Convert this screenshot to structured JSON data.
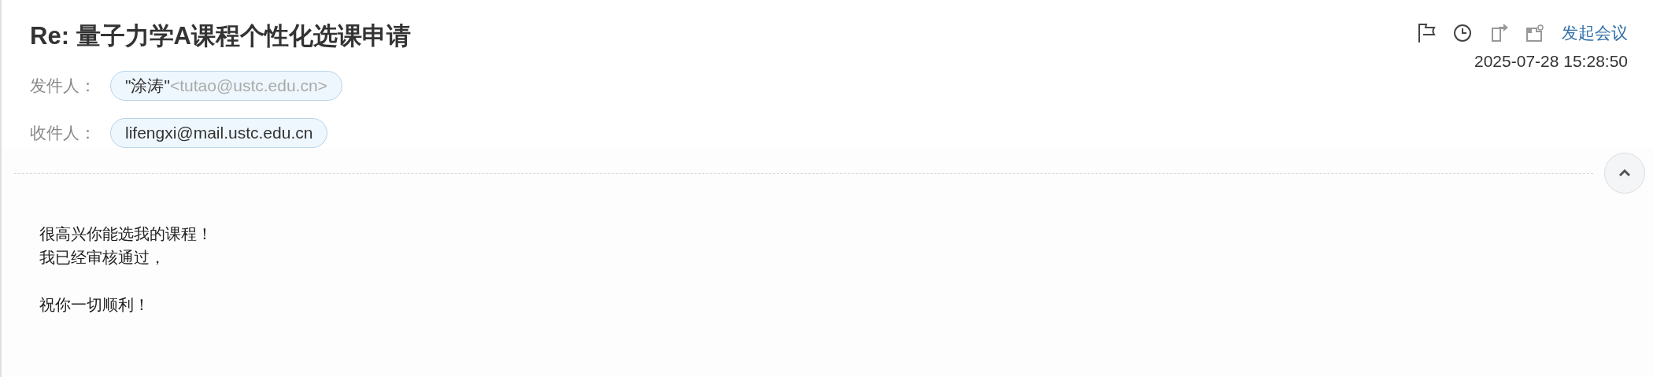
{
  "subject": "Re: 量子力学A课程个性化选课申请",
  "toolbar": {
    "link": "发起会议"
  },
  "date": "2025-07-28 15:28:50",
  "sender": {
    "label": "发件人：",
    "name": "\"涂涛\"",
    "address": "<tutao@ustc.edu.cn>"
  },
  "recipients": {
    "label": "收件人：",
    "items": [
      "lifengxi@mail.ustc.edu.cn"
    ]
  },
  "body": {
    "paragraphs": [
      [
        "很高兴你能选我的课程！",
        "我已经审核通过，"
      ],
      [
        "祝你一切顺利！"
      ]
    ]
  }
}
